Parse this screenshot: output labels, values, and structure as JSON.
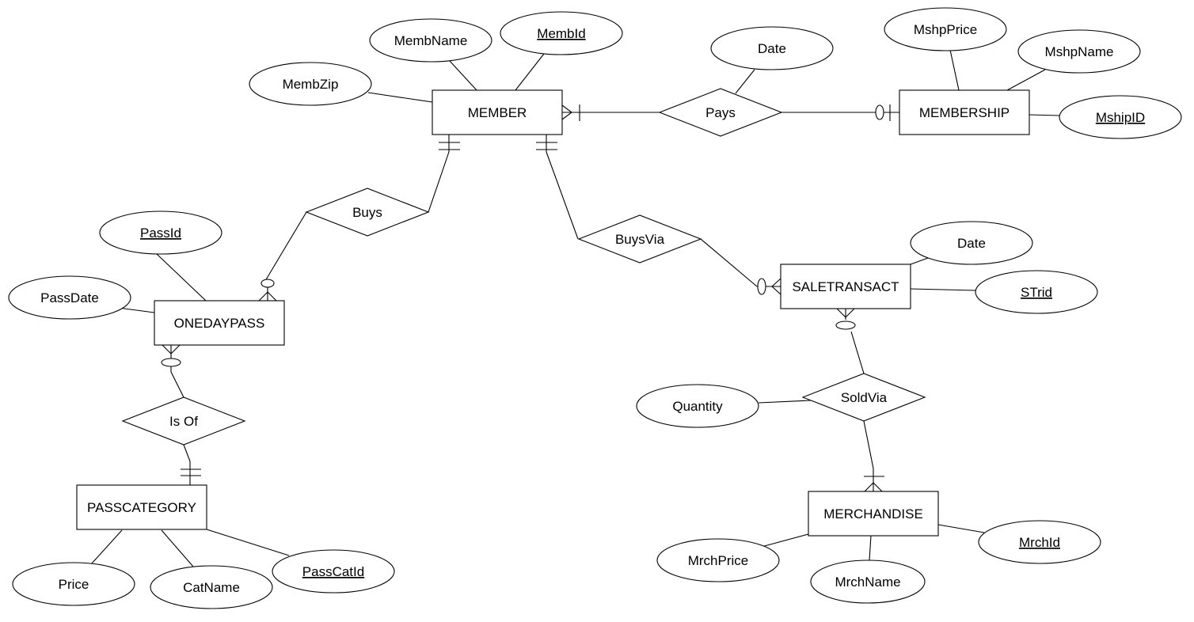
{
  "diagram": {
    "type": "ER diagram (crow's foot notation)",
    "entities": [
      {
        "id": "member",
        "label": "MEMBER"
      },
      {
        "id": "membership",
        "label": "MEMBERSHIP"
      },
      {
        "id": "onedaypass",
        "label": "ONEDAYPASS"
      },
      {
        "id": "passcategory",
        "label": "PASSCATEGORY"
      },
      {
        "id": "saletransact",
        "label": "SALETRANSACT"
      },
      {
        "id": "merchandise",
        "label": "MERCHANDISE"
      }
    ],
    "relationships": [
      {
        "id": "pays",
        "label": "Pays"
      },
      {
        "id": "buys",
        "label": "Buys"
      },
      {
        "id": "buysvia",
        "label": "BuysVia"
      },
      {
        "id": "isof",
        "label": "Is Of"
      },
      {
        "id": "soldvia",
        "label": "SoldVia"
      }
    ],
    "attributes": [
      {
        "id": "membname",
        "label": "MembName",
        "key": false,
        "owner": "member"
      },
      {
        "id": "membid",
        "label": "MembId",
        "key": true,
        "owner": "member"
      },
      {
        "id": "membzip",
        "label": "MembZip",
        "key": false,
        "owner": "member"
      },
      {
        "id": "paysdate",
        "label": "Date",
        "key": false,
        "owner": "pays"
      },
      {
        "id": "mshpprice",
        "label": "MshpPrice",
        "key": false,
        "owner": "membership"
      },
      {
        "id": "mshpname",
        "label": "MshpName",
        "key": false,
        "owner": "membership"
      },
      {
        "id": "mshipid",
        "label": "MshipID",
        "key": true,
        "owner": "membership"
      },
      {
        "id": "passid",
        "label": "PassId",
        "key": true,
        "owner": "onedaypass"
      },
      {
        "id": "passdate",
        "label": "PassDate",
        "key": false,
        "owner": "onedaypass"
      },
      {
        "id": "price",
        "label": "Price",
        "key": false,
        "owner": "passcategory"
      },
      {
        "id": "catname",
        "label": "CatName",
        "key": false,
        "owner": "passcategory"
      },
      {
        "id": "passcatid",
        "label": "PassCatId",
        "key": true,
        "owner": "passcategory"
      },
      {
        "id": "stdate",
        "label": "Date",
        "key": false,
        "owner": "saletransact"
      },
      {
        "id": "strid",
        "label": "STrid",
        "key": true,
        "owner": "saletransact"
      },
      {
        "id": "quantity",
        "label": "Quantity",
        "key": false,
        "owner": "soldvia"
      },
      {
        "id": "mrchprice",
        "label": "MrchPrice",
        "key": false,
        "owner": "merchandise"
      },
      {
        "id": "mrchname",
        "label": "MrchName",
        "key": false,
        "owner": "merchandise"
      },
      {
        "id": "mrchid",
        "label": "MrchId",
        "key": true,
        "owner": "merchandise"
      }
    ],
    "cardinalities": [
      {
        "relationship": "pays",
        "entity": "member",
        "min": "mandatory",
        "max": "many"
      },
      {
        "relationship": "pays",
        "entity": "membership",
        "min": "optional",
        "max": "one"
      },
      {
        "relationship": "buys",
        "entity": "member",
        "min": "mandatory",
        "max": "one"
      },
      {
        "relationship": "buys",
        "entity": "onedaypass",
        "min": "optional",
        "max": "many"
      },
      {
        "relationship": "buysvia",
        "entity": "member",
        "min": "mandatory",
        "max": "one"
      },
      {
        "relationship": "buysvia",
        "entity": "saletransact",
        "min": "optional",
        "max": "many"
      },
      {
        "relationship": "isof",
        "entity": "onedaypass",
        "min": "optional",
        "max": "many"
      },
      {
        "relationship": "isof",
        "entity": "passcategory",
        "min": "mandatory",
        "max": "one"
      },
      {
        "relationship": "soldvia",
        "entity": "saletransact",
        "min": "optional",
        "max": "many"
      },
      {
        "relationship": "soldvia",
        "entity": "merchandise",
        "min": "mandatory",
        "max": "many"
      }
    ]
  }
}
